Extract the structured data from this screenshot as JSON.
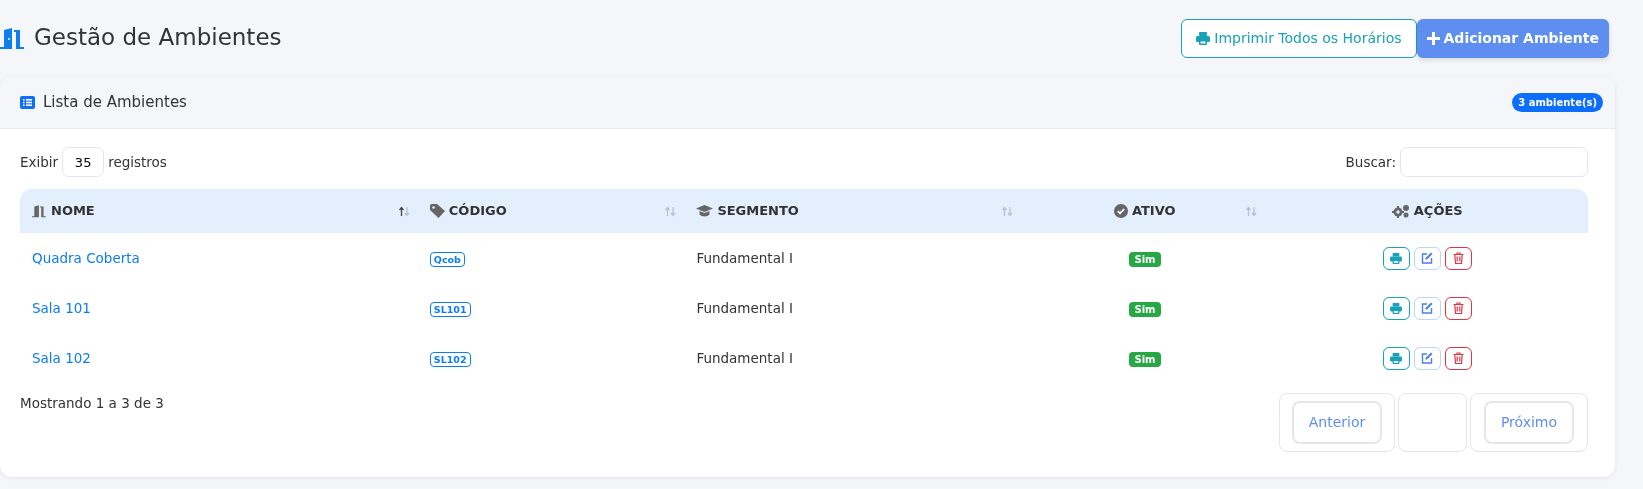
{
  "page": {
    "title": "Gestão de Ambientes"
  },
  "header_buttons": [
    {
      "kind": "print",
      "label": "Imprimir Todos os Horários"
    },
    {
      "kind": "add",
      "label": "Adicionar Ambiente"
    }
  ],
  "card": {
    "title": "Lista de Ambientes",
    "count_badge": "3 ambiente(s)"
  },
  "length_control": {
    "before": "Exibir",
    "value": "35",
    "after": "registros"
  },
  "search": {
    "label": "Buscar:"
  },
  "table": {
    "columns": [
      {
        "kind": "nome",
        "label": "NOME",
        "sortable": true,
        "sorted": true
      },
      {
        "kind": "codigo",
        "label": "CÓDIGO",
        "sortable": true,
        "sorted": false
      },
      {
        "kind": "segmento",
        "label": "SEGMENTO",
        "sortable": true,
        "sorted": false
      },
      {
        "kind": "ativo",
        "label": "ATIVO",
        "sortable": true,
        "sorted": false
      },
      {
        "kind": "acoes",
        "label": "AÇÕES"
      }
    ],
    "rows": [
      {
        "nome": "Quadra Coberta",
        "codigo": "Qcob",
        "segmento": "Fundamental I",
        "ativo": "Sim",
        "active": true
      },
      {
        "nome": "Sala 101",
        "codigo": "SL101",
        "segmento": "Fundamental I",
        "ativo": "Sim",
        "active": true
      },
      {
        "nome": "Sala 102",
        "codigo": "SL102",
        "segmento": "Fundamental I",
        "ativo": "Sim",
        "active": true
      }
    ]
  },
  "info": "Mostrando 1 a 3 de 3",
  "pagination": {
    "previous": "Anterior",
    "next": "Próximo"
  }
}
